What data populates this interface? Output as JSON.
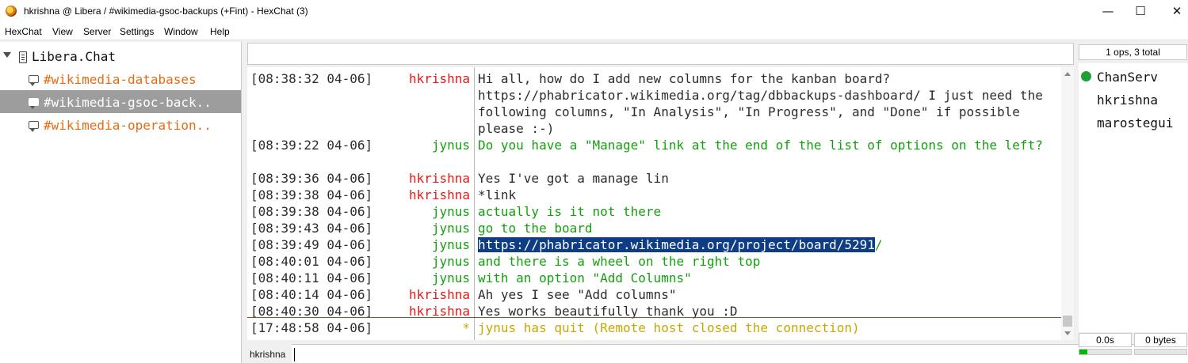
{
  "window": {
    "title": "hkrishna @ Libera / #wikimedia-gsoc-backups (+Fint) - HexChat (3)",
    "controls": {
      "minimize": "—",
      "maximize": "☐",
      "close": "✕"
    }
  },
  "menu": [
    {
      "label": "HexChat"
    },
    {
      "label": "View"
    },
    {
      "label": "Server"
    },
    {
      "label": "Settings"
    },
    {
      "label": "Window"
    },
    {
      "label": "Help"
    }
  ],
  "tree": {
    "server": "Libera.Chat",
    "channels": [
      {
        "label": "#wikimedia-databases",
        "selected": false
      },
      {
        "label": "#wikimedia-gsoc-back..",
        "selected": true
      },
      {
        "label": "#wikimedia-operation..",
        "selected": false
      }
    ]
  },
  "topic": "",
  "messages": [
    {
      "time": "[08:38:32 04-06]",
      "nick": "hkrishna",
      "text": "Hi all, how do I add new columns for the kanban board? https://phabricator.wikimedia.org/tag/dbbackups-dashboard/ I just need the following columns, \"In Analysis\", \"In Progress\", and \"Done\" if possible please :-)"
    },
    {
      "time": "[08:39:22 04-06]",
      "nick": "jynus",
      "text": "Do you have a \"Manage\" link at the end of the list of options on the left?"
    },
    {
      "time": "[08:39:36 04-06]",
      "nick": "hkrishna",
      "text": "Yes I've got a manage lin"
    },
    {
      "time": "[08:39:38 04-06]",
      "nick": "hkrishna",
      "text": "*link"
    },
    {
      "time": "[08:39:38 04-06]",
      "nick": "jynus",
      "text": "actually is it not there"
    },
    {
      "time": "[08:39:43 04-06]",
      "nick": "jynus",
      "text": "go to the board"
    },
    {
      "time": "[08:39:49 04-06]",
      "nick": "jynus",
      "text_selected": "https://phabricator.wikimedia.org/project/board/5291",
      "text_rest": "/"
    },
    {
      "time": "[08:40:01 04-06]",
      "nick": "jynus",
      "text": "and there is a wheel on the right top"
    },
    {
      "time": "[08:40:11 04-06]",
      "nick": "jynus",
      "text": "with an option \"Add Columns\""
    },
    {
      "time": "[08:40:14 04-06]",
      "nick": "hkrishna",
      "text": "Ah yes I see \"Add columns\""
    },
    {
      "time": "[08:40:30 04-06]",
      "nick": "hkrishna",
      "text": "Yes works beautifully thank you :D"
    },
    {
      "time": "[17:48:58 04-06]",
      "nick": "*",
      "text": "jynus has quit (Remote host closed the connection)"
    }
  ],
  "nick_colors": {
    "hkrishna": "#e01b1b",
    "jynus": "#15a00f",
    "*": "#c8a800"
  },
  "text_colors": {
    "hkrishna": "#2c2c2c",
    "jynus": "#15a00f",
    "*": "#c8a800"
  },
  "input": {
    "nick": "hkrishna",
    "value": ""
  },
  "userlist": {
    "summary": "1 ops, 3 total",
    "users": [
      {
        "name": "ChanServ",
        "op": true
      },
      {
        "name": "hkrishna",
        "op": false
      },
      {
        "name": "marostegui",
        "op": false
      }
    ]
  },
  "status": {
    "lag": "0.0s",
    "queue": "0 bytes",
    "lag_level": 0.15
  }
}
